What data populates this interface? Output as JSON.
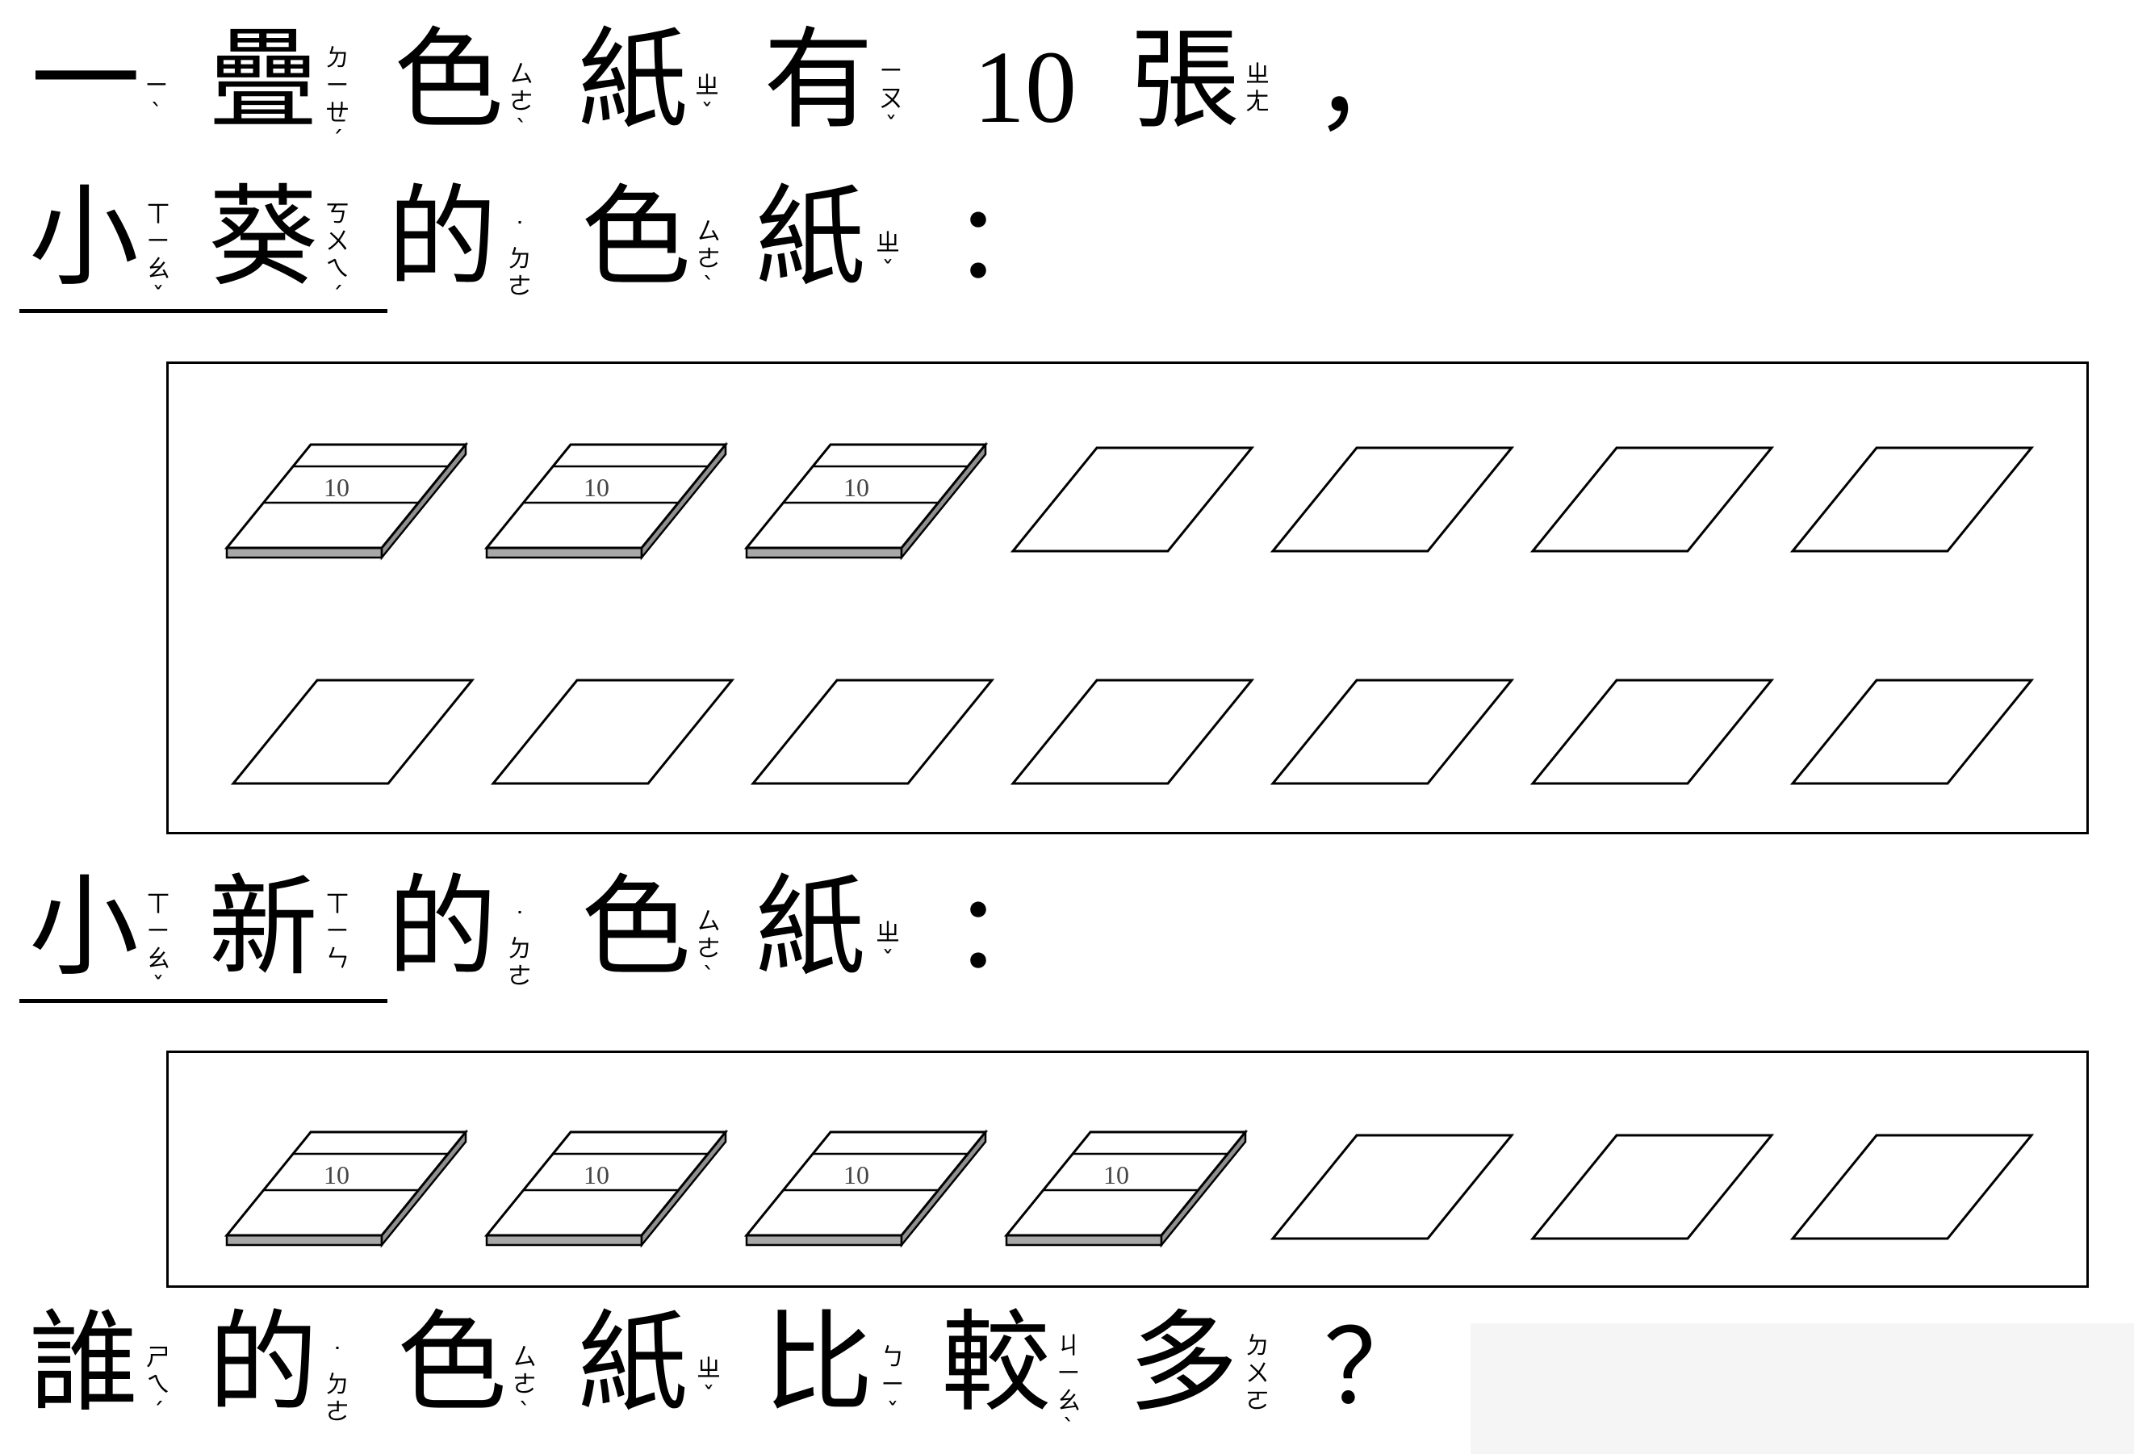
{
  "intro": {
    "word1": "一",
    "zy1": "ㄧˋ",
    "word2": "疊",
    "zy2": "ㄉㄧㄝˊ",
    "word3": "色",
    "zy3": "ㄙㄜˋ",
    "word4": "紙",
    "zy4": "ㄓˇ",
    "word5": "有",
    "zy5": "ㄧㄡˇ",
    "count": "10",
    "word6": "張",
    "zy6": "ㄓㄤ",
    "punct": "，"
  },
  "xiaokui": {
    "name1": "小",
    "name1_zy": "ㄒㄧㄠˇ",
    "name2": "葵",
    "name2_zy": "ㄎㄨㄟˊ",
    "de": "的",
    "de_zy": "˙ㄉㄜ",
    "se": "色",
    "se_zy": "ㄙㄜˋ",
    "zhi": "紙",
    "zhi_zy": "ㄓˇ",
    "colon": "：",
    "bundle_label": "10",
    "bundles": 3,
    "singles_row1": 4,
    "singles_row2": 7
  },
  "xiaoxin": {
    "name1": "小",
    "name1_zy": "ㄒㄧㄠˇ",
    "name2": "新",
    "name2_zy": "ㄒㄧㄣ",
    "de": "的",
    "de_zy": "˙ㄉㄜ",
    "se": "色",
    "se_zy": "ㄙㄜˋ",
    "zhi": "紙",
    "zhi_zy": "ㄓˇ",
    "colon": "：",
    "bundle_label": "10",
    "bundles": 4,
    "singles": 3
  },
  "question": {
    "w1": "誰",
    "w1_zy": "ㄕㄟˊ",
    "w2": "的",
    "w2_zy": "˙ㄉㄜ",
    "w3": "色",
    "w3_zy": "ㄙㄜˋ",
    "w4": "紙",
    "w4_zy": "ㄓˇ",
    "w5": "比",
    "w5_zy": "ㄅㄧˇ",
    "w6": "較",
    "w6_zy": "ㄐㄧㄠˋ",
    "w7": "多",
    "w7_zy": "ㄉㄨㄛ",
    "mark": "？"
  }
}
